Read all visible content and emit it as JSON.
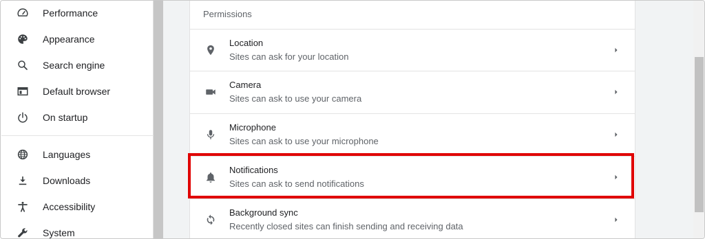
{
  "colors": {
    "accent_highlight": "#e00000",
    "icon_color": "#5f6368",
    "sidebar_icon_color": "#3c4043"
  },
  "sidebar": {
    "items": [
      {
        "label": "Performance",
        "icon": "speedometer-icon"
      },
      {
        "label": "Appearance",
        "icon": "palette-icon"
      },
      {
        "label": "Search engine",
        "icon": "search-icon"
      },
      {
        "label": "Default browser",
        "icon": "browser-window-icon"
      },
      {
        "label": "On startup",
        "icon": "power-icon"
      },
      {
        "label": "Languages",
        "icon": "globe-icon"
      },
      {
        "label": "Downloads",
        "icon": "download-icon"
      },
      {
        "label": "Accessibility",
        "icon": "accessibility-icon"
      },
      {
        "label": "System",
        "icon": "wrench-icon"
      }
    ]
  },
  "main": {
    "section_title": "Permissions",
    "rows": [
      {
        "title": "Location",
        "subtitle": "Sites can ask for your location",
        "icon": "location-pin-icon"
      },
      {
        "title": "Camera",
        "subtitle": "Sites can ask to use your camera",
        "icon": "camera-icon"
      },
      {
        "title": "Microphone",
        "subtitle": "Sites can ask to use your microphone",
        "icon": "microphone-icon"
      },
      {
        "title": "Notifications",
        "subtitle": "Sites can ask to send notifications",
        "icon": "bell-icon"
      },
      {
        "title": "Background sync",
        "subtitle": "Recently closed sites can finish sending and receiving data",
        "icon": "sync-icon"
      }
    ]
  }
}
